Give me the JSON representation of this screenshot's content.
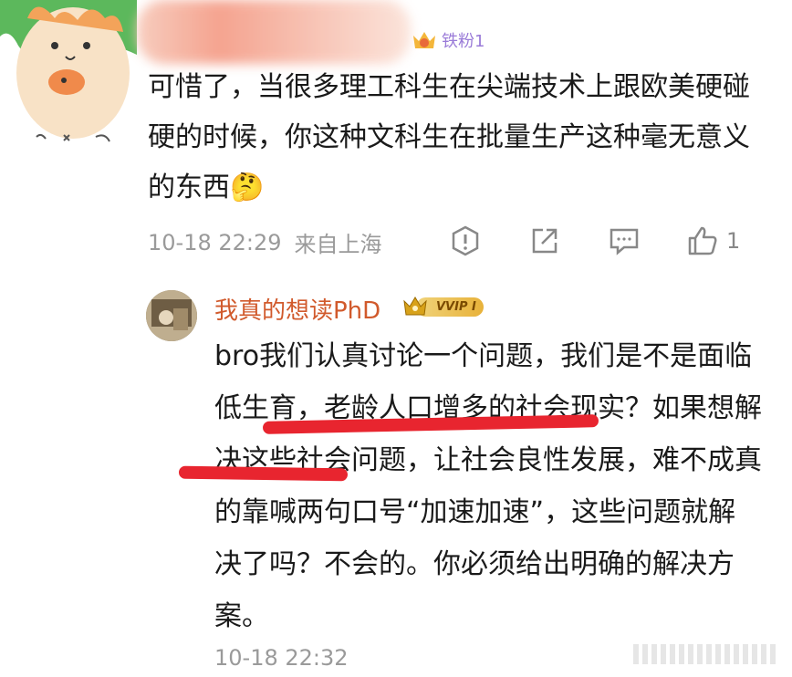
{
  "top_comment": {
    "badge": "铁粉1",
    "text": "可惜了，当很多理工科生在尖端技术上跟欧美硬碰硬的时候，你这种文科生在批量生产这种毫无意义的东西🤔",
    "time": "10-18 22:29",
    "location": "来自上海",
    "like_count": "1"
  },
  "reply": {
    "username": "我真的想读PhD",
    "vip_label": "VVIP I",
    "text": "bro我们认真讨论一个问题，我们是不是面临低生育，老龄人口增多的社会现实？如果想解决这些社会问题，让社会良性发展，难不成真的靠喊两句口号“加速加速”，这些问题就解决了吗？不会的。你必须给出明确的解决方案。",
    "time": "10-18 22:32"
  },
  "icons": [
    "cat-avatar-icon",
    "report-icon",
    "share-icon",
    "comment-icon",
    "like-icon",
    "crown-badge-icon"
  ],
  "colors": {
    "username": "#d15a2c",
    "meta": "#9a9a9a",
    "underline": "#e8252f",
    "badge": "#9a7bd8"
  }
}
